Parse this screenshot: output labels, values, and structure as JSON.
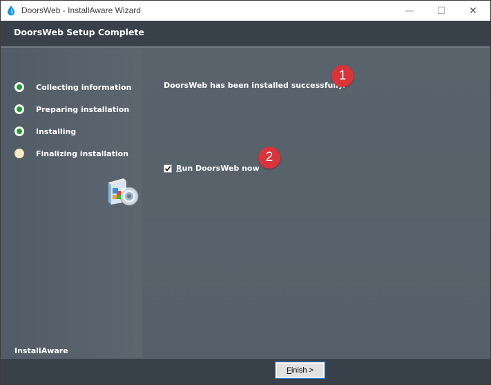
{
  "window": {
    "title": "DoorsWeb - InstallAware Wizard",
    "controls": {
      "minimize": "—",
      "maximize": "☐",
      "close": "✕"
    }
  },
  "header": {
    "title": "DoorsWeb Setup Complete"
  },
  "steps": [
    {
      "label": "Collecting information",
      "state": "done"
    },
    {
      "label": "Preparing installation",
      "state": "done"
    },
    {
      "label": "Installing",
      "state": "done"
    },
    {
      "label": "Finalizing installation",
      "state": "current"
    }
  ],
  "main": {
    "message": "DoorsWeb has been installed successfully.",
    "run_checkbox": {
      "checked": true,
      "mnemonic": "R",
      "label_rest": "un DoorsWeb now"
    }
  },
  "badges": {
    "one": "1",
    "two": "2"
  },
  "footer": {
    "brand": "InstallAware",
    "finish": {
      "mnemonic": "F",
      "label_rest": "inish >"
    }
  },
  "colors": {
    "badge": "#d9343a",
    "step_done": "#1e9e2e",
    "header_bg": "#38414a",
    "panel_bg": "#59636c"
  }
}
